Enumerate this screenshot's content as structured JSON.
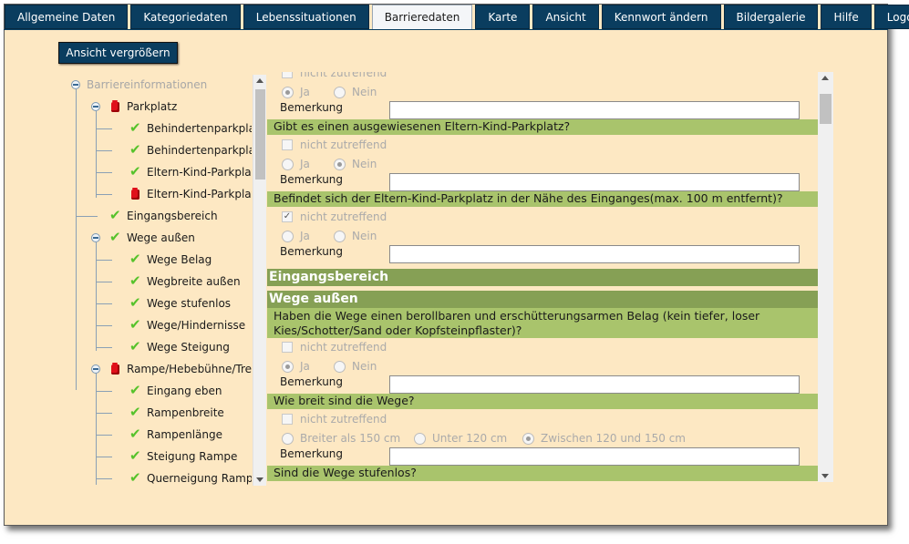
{
  "tabs": [
    {
      "label": "Allgemeine Daten",
      "active": false
    },
    {
      "label": "Kategoriedaten",
      "active": false
    },
    {
      "label": "Lebenssituationen",
      "active": false
    },
    {
      "label": "Barrieredaten",
      "active": true
    },
    {
      "label": "Karte",
      "active": false
    },
    {
      "label": "Ansicht",
      "active": false
    },
    {
      "label": "Kennwort ändern",
      "active": false
    },
    {
      "label": "Bildergalerie",
      "active": false
    },
    {
      "label": "Hilfe",
      "active": false
    },
    {
      "label": "Logout",
      "active": false
    }
  ],
  "enlarge_button": "Ansicht vergrößern",
  "tree": {
    "root": "Barriereinformationen",
    "items": [
      {
        "label": "Parkplatz",
        "status": "red",
        "level": 1,
        "expandable": true
      },
      {
        "label": "Behindertenparkplatz",
        "status": "check",
        "level": 2
      },
      {
        "label": "Behindertenparkplatz/",
        "status": "check",
        "level": 2
      },
      {
        "label": "Eltern-Kind-Parkplatz",
        "status": "check",
        "level": 2
      },
      {
        "label": "Eltern-Kind-Parkplatz/",
        "status": "red",
        "level": 2
      },
      {
        "label": "Eingangsbereich",
        "status": "check",
        "level": 1
      },
      {
        "label": "Wege außen",
        "status": "check",
        "level": 1,
        "expandable": true
      },
      {
        "label": "Wege Belag",
        "status": "check",
        "level": 2
      },
      {
        "label": "Wegbreite außen",
        "status": "check",
        "level": 2
      },
      {
        "label": "Wege stufenlos",
        "status": "check",
        "level": 2
      },
      {
        "label": "Wege/Hindernisse",
        "status": "check",
        "level": 2
      },
      {
        "label": "Wege Steigung",
        "status": "check",
        "level": 2
      },
      {
        "label": "Rampe/Hebebühne/Trepp",
        "status": "red",
        "level": 1,
        "expandable": true
      },
      {
        "label": "Eingang eben",
        "status": "check",
        "level": 2
      },
      {
        "label": "Rampenbreite",
        "status": "check",
        "level": 2
      },
      {
        "label": "Rampenlänge",
        "status": "check",
        "level": 2
      },
      {
        "label": "Steigung Rampe",
        "status": "check",
        "level": 2
      },
      {
        "label": "Querneigung Rampe",
        "status": "check",
        "level": 2
      }
    ]
  },
  "form": {
    "not_applicable": "nicht zutreffend",
    "yes": "Ja",
    "no": "Nein",
    "remark": "Bemerkung",
    "q_parking_family": "Gibt es einen ausgewiesenen Eltern-Kind-Parkplatz?",
    "q_parking_near": "Befindet sich der Eltern-Kind-Parkplatz in der Nähe des Einganges(max. 100 m entfernt)?",
    "section_entrance": "Eingangsbereich",
    "section_paths": "Wege außen",
    "q_surface_line1": "Haben die Wege einen berollbaren und erschütterungsarmen Belag (kein tiefer, loser",
    "q_surface_line2": "Kies/Schotter/Sand oder Kopfsteinpflaster)?",
    "q_width": "Wie breit sind die Wege?",
    "width_opt1": "Breiter als 150 cm",
    "width_opt2": "Unter 120 cm",
    "width_opt3": "Zwischen 120 und 150 cm",
    "q_stepfree": "Sind die Wege stufenlos?"
  }
}
